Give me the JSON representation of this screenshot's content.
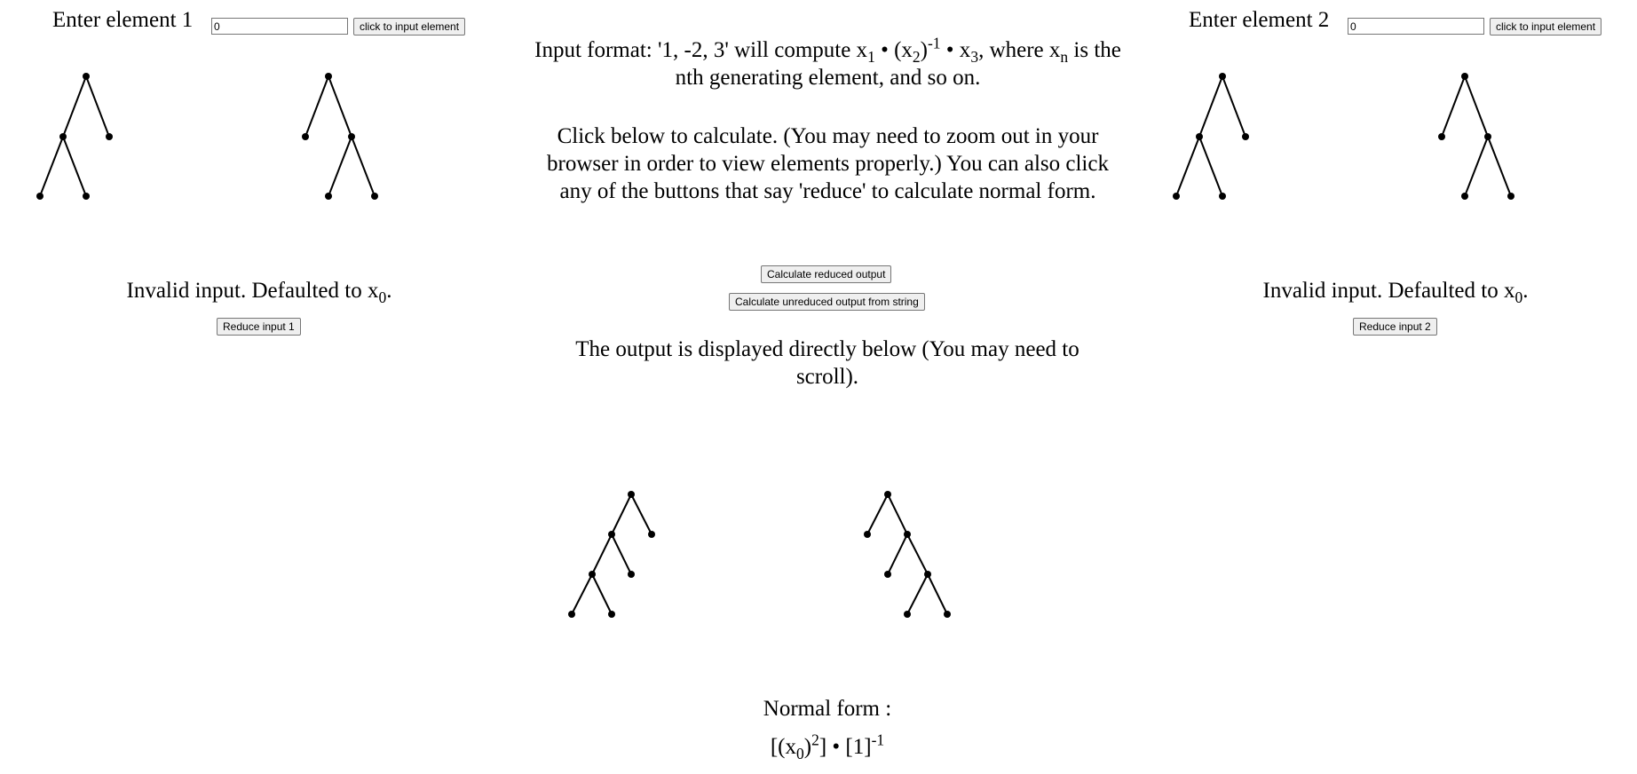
{
  "element1": {
    "label": "Enter element 1",
    "input_value": "0",
    "input_button": "click to input element",
    "status_prefix": "Invalid input. Defaulted to x",
    "status_sub": "0",
    "status_suffix": ".",
    "reduce_button": "Reduce input 1"
  },
  "element2": {
    "label": "Enter element 2",
    "input_value": "0",
    "input_button": "click to input element",
    "status_prefix": "Invalid input. Defaulted to x",
    "status_sub": "0",
    "status_suffix": ".",
    "reduce_button": "Reduce input 2"
  },
  "instructions": {
    "format_a": "Input format: '1, -2, 3' will compute x",
    "format_sub1": "1",
    "format_b": " • (x",
    "format_sub2": "2",
    "format_c": ")",
    "format_sup": "-1",
    "format_d": " • x",
    "format_sub3": "3",
    "format_e": ", where x",
    "format_subn": "n",
    "format_f": " is the nth generating element, and so on.",
    "calculate_text": "Click below to calculate. (You may need to zoom out in your browser in order to view elements properly.) You can also click any of the buttons that say 'reduce' to calculate normal form."
  },
  "actions": {
    "calc_reduced": "Calculate reduced output",
    "calc_unreduced": "Calculate unreduced output from string"
  },
  "output": {
    "note": "The output is displayed directly below (You may need to scroll).",
    "normal_form_label": "Normal form :",
    "nf_a": "[(x",
    "nf_sub": "0",
    "nf_b": ")",
    "nf_sup1": "2",
    "nf_c": "] • [1]",
    "nf_sup2": "-1"
  }
}
